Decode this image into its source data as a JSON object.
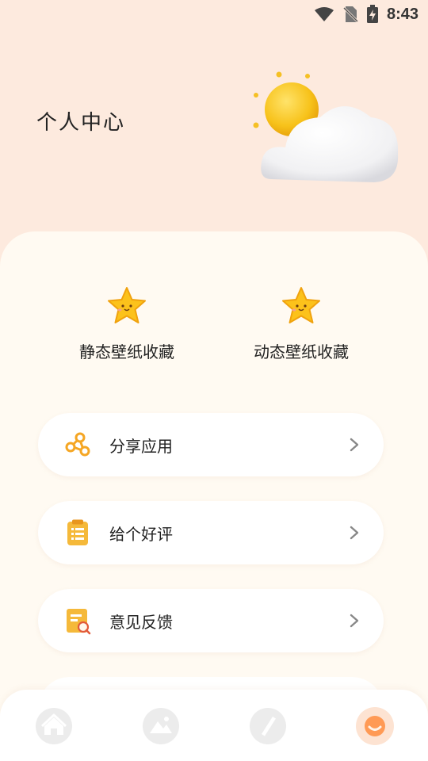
{
  "status_bar": {
    "time": "8:43"
  },
  "header": {
    "title": "个人中心"
  },
  "favorites": [
    {
      "label": "静态壁纸收藏",
      "icon": "star-icon"
    },
    {
      "label": "动态壁纸收藏",
      "icon": "star-icon"
    }
  ],
  "menu": [
    {
      "label": "分享应用",
      "icon": "share-icon"
    },
    {
      "label": "给个好评",
      "icon": "clipboard-icon"
    },
    {
      "label": "意见反馈",
      "icon": "feedback-icon"
    }
  ],
  "bottom_nav": [
    {
      "icon": "home-icon",
      "active": false
    },
    {
      "icon": "image-icon",
      "active": false
    },
    {
      "icon": "pen-icon",
      "active": false
    },
    {
      "icon": "profile-face-icon",
      "active": true
    }
  ],
  "colors": {
    "background": "#fdeade",
    "panel": "#fffaf2",
    "accent": "#f5a623",
    "active_nav": "#fde3d2"
  }
}
